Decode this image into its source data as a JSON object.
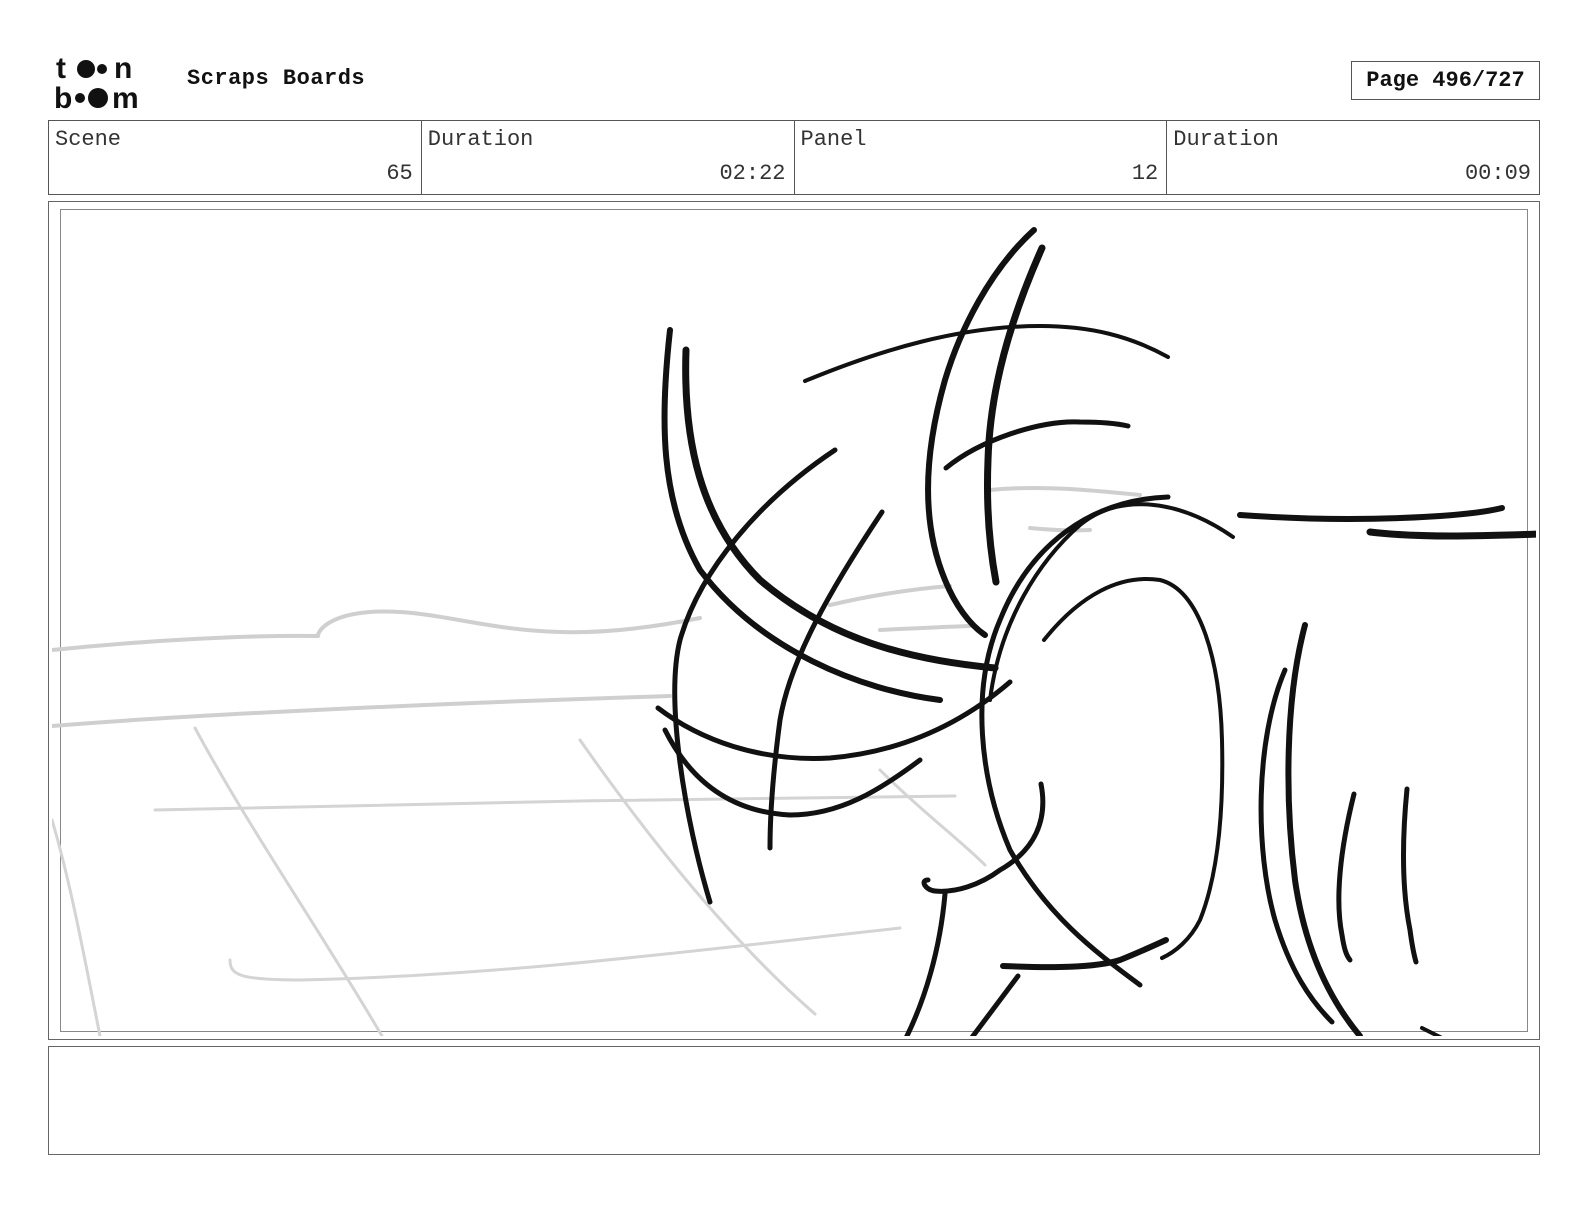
{
  "header": {
    "logo_top": "t●●n",
    "logo_bottom": "b●●m",
    "title": "Scraps Boards",
    "page_label": "Page 496/727"
  },
  "info": [
    {
      "label": "Scene",
      "value": "65"
    },
    {
      "label": "Duration",
      "value": "02:22"
    },
    {
      "label": "Panel",
      "value": "12"
    },
    {
      "label": "Duration",
      "value": "00:09"
    }
  ],
  "notes": {
    "text": ""
  },
  "colors": {
    "ink": "#111111",
    "background_sketch": "#cfcfcf",
    "frame": "#666666"
  }
}
